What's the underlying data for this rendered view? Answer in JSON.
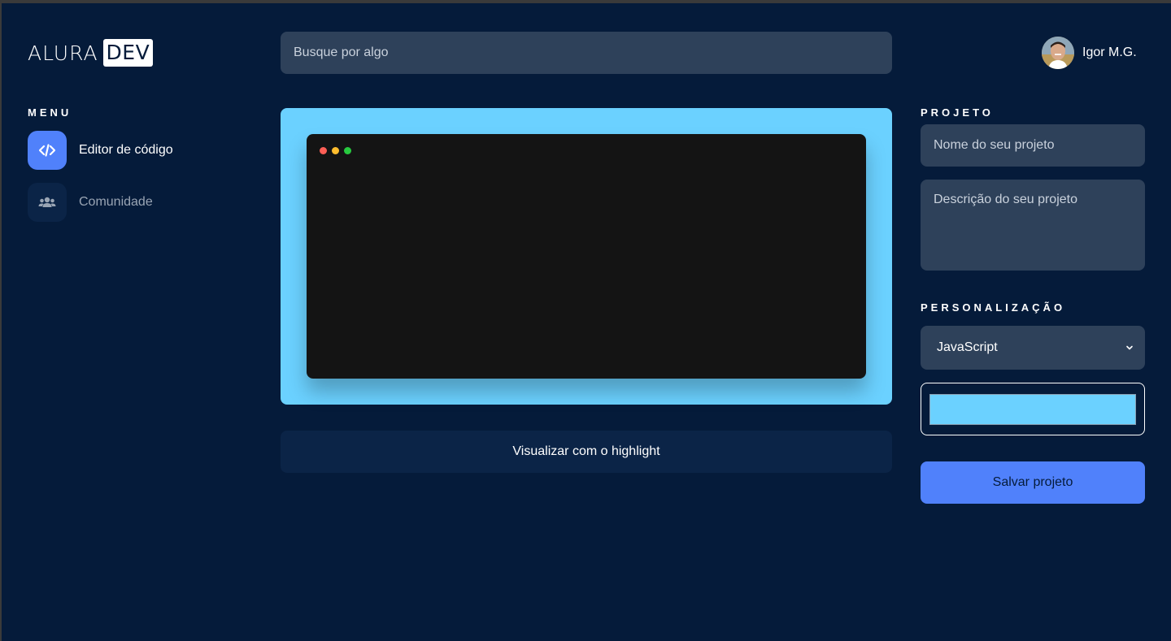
{
  "logo": {
    "brand": "ALURA",
    "tag": "DEV"
  },
  "search": {
    "placeholder": "Busque por algo"
  },
  "user": {
    "name": "Igor M.G."
  },
  "menu": {
    "title": "MENU",
    "items": [
      {
        "label": "Editor de código",
        "icon": "code-icon",
        "active": true
      },
      {
        "label": "Comunidade",
        "icon": "users-icon",
        "active": false
      }
    ]
  },
  "editor": {
    "window_dots": [
      "#FF5F56",
      "#FFBD2E",
      "#27C93F"
    ],
    "background_color": "#6BD1FF",
    "highlight_button": "Visualizar com o highlight"
  },
  "project": {
    "title": "PROJETO",
    "name_placeholder": "Nome do seu projeto",
    "description_placeholder": "Descrição do seu projeto"
  },
  "customization": {
    "title": "PERSONALIZAÇÃO",
    "language": "JavaScript",
    "color": "#6BD1FF"
  },
  "actions": {
    "save_label": "Salvar projeto"
  },
  "colors": {
    "background": "#051B3A",
    "field": "#2E415A",
    "accent": "#5081FB",
    "secondary_button": "#0B2447"
  }
}
